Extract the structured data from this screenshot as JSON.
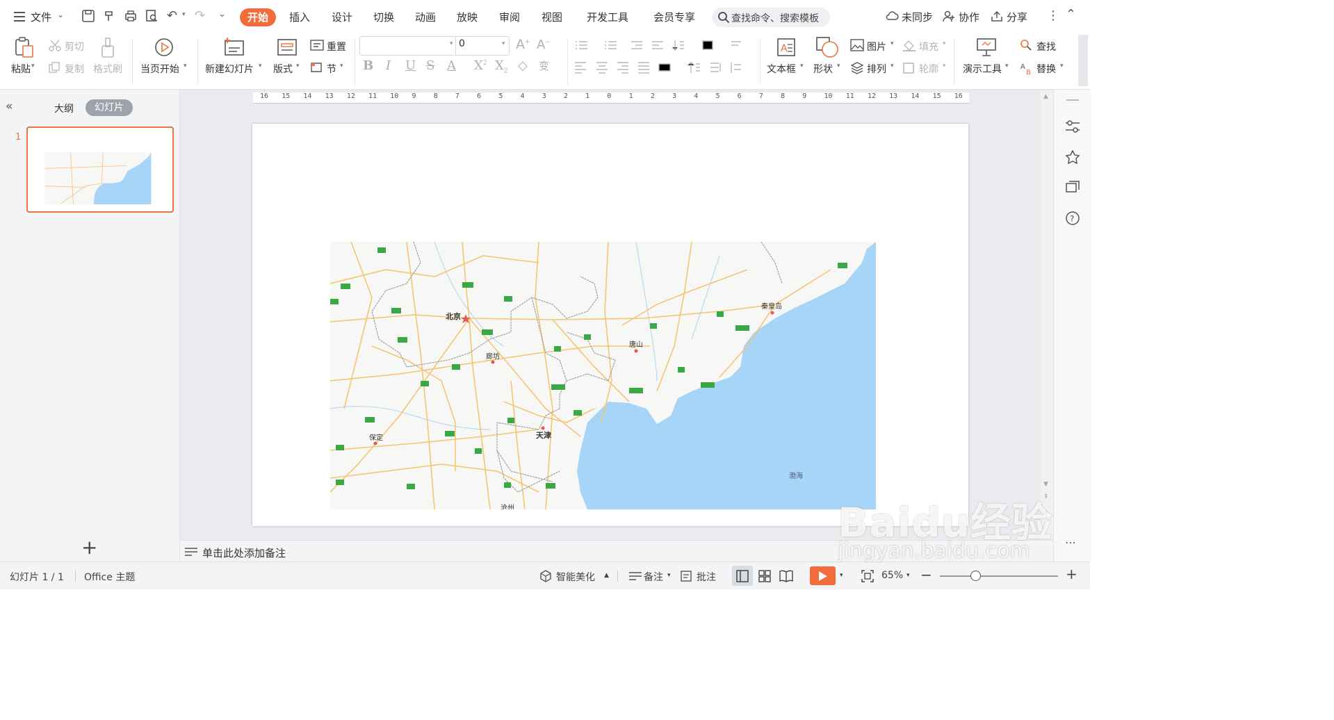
{
  "menubar": {
    "file_label": "文件",
    "tabs": [
      {
        "label": "开始",
        "active": true
      },
      {
        "label": "插入"
      },
      {
        "label": "设计"
      },
      {
        "label": "切换"
      },
      {
        "label": "动画"
      },
      {
        "label": "放映"
      },
      {
        "label": "审阅"
      },
      {
        "label": "视图"
      },
      {
        "label": "开发工具"
      },
      {
        "label": "会员专享"
      }
    ],
    "search_placeholder": "查找命令、搜索模板",
    "sync_label": "未同步",
    "collab_label": "协作",
    "share_label": "分享"
  },
  "ribbon": {
    "paste": "粘贴",
    "cut": "剪切",
    "copy": "复制",
    "format_painter": "格式刷",
    "from_current": "当页开始",
    "new_slide": "新建幻灯片",
    "layout": "版式",
    "reset": "重置",
    "section": "节",
    "font_size_value": "0",
    "textbox": "文本框",
    "shape": "形状",
    "picture": "图片",
    "arrange": "排列",
    "fill": "填充",
    "outline": "轮廓",
    "presenter_tools": "演示工具",
    "find": "查找",
    "replace": "替换"
  },
  "left_panel": {
    "outline_tab": "大纲",
    "slides_tab": "幻灯片",
    "slide_number": "1",
    "add_button": "+"
  },
  "ruler": {
    "ticks": [
      "16",
      "15",
      "14",
      "13",
      "12",
      "11",
      "10",
      "9",
      "8",
      "7",
      "6",
      "5",
      "4",
      "3",
      "2",
      "1",
      "0",
      "1",
      "2",
      "3",
      "4",
      "5",
      "6",
      "7",
      "8",
      "9",
      "10",
      "11",
      "12",
      "13",
      "14",
      "15",
      "16"
    ]
  },
  "map": {
    "cities": {
      "beijing": "北京",
      "tianjin": "天津",
      "langfang": "廊坊",
      "tangshan": "唐山",
      "qinhuangdao": "秦皇岛",
      "baoding": "保定",
      "cangzhou": "沧州",
      "bohai": "渤海"
    },
    "colors": {
      "sea": "#a7d5f7",
      "land": "#f7f7f5",
      "road": "#f5c36b",
      "border": "#9a9a9a"
    }
  },
  "notes": {
    "placeholder": "单击此处添加备注"
  },
  "statusbar": {
    "slide_counter": "幻灯片 1 / 1",
    "theme": "Office 主题",
    "smart_beautify": "智能美化",
    "notes": "备注",
    "comments": "批注",
    "zoom": "65%",
    "zoom_minus": "−",
    "zoom_plus": "+"
  },
  "watermark": {
    "main": "Baidu经验",
    "sub": "jingyan.baidu.com"
  }
}
